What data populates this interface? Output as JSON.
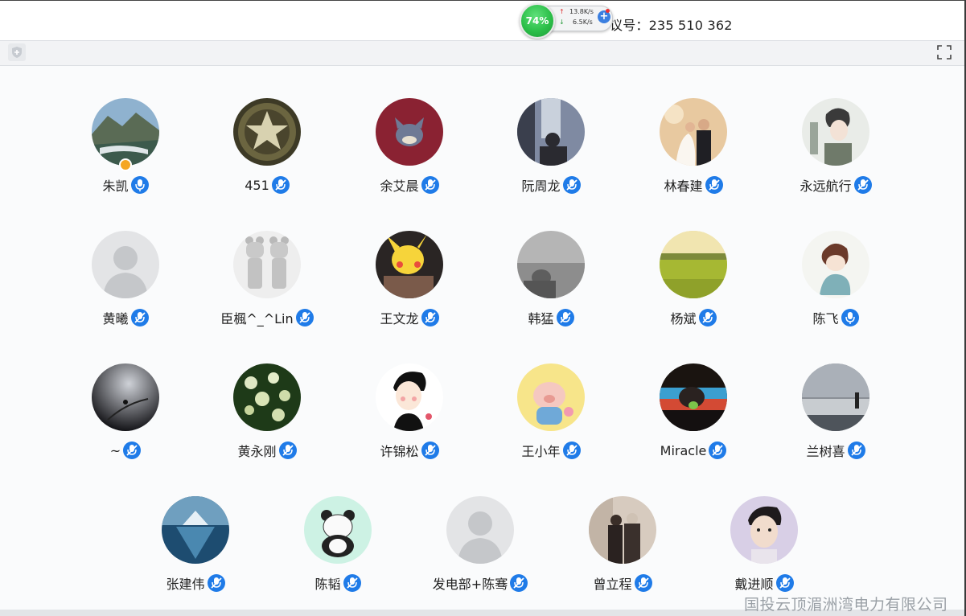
{
  "meeting": {
    "id_label": "议号：235 510 362"
  },
  "net_widget": {
    "percent": "74%",
    "upload": "13.8K/s",
    "download": "6.5K/s"
  },
  "participants": [
    {
      "name": "朱凯",
      "mic": "on",
      "host": true
    },
    {
      "name": "451",
      "mic": "muted"
    },
    {
      "name": "余艾晨",
      "mic": "muted"
    },
    {
      "name": "阮周龙",
      "mic": "muted"
    },
    {
      "name": "林春建",
      "mic": "muted"
    },
    {
      "name": "永远航行",
      "mic": "muted"
    },
    {
      "name": "黄曦",
      "mic": "muted"
    },
    {
      "name": "臣楓^_^Lin",
      "mic": "muted"
    },
    {
      "name": "王文龙",
      "mic": "muted"
    },
    {
      "name": "韩猛",
      "mic": "muted"
    },
    {
      "name": "杨斌",
      "mic": "muted"
    },
    {
      "name": "陈飞",
      "mic": "on"
    },
    {
      "name": "~",
      "mic": "muted"
    },
    {
      "name": "黄永刚",
      "mic": "muted"
    },
    {
      "name": "许锦松",
      "mic": "muted"
    },
    {
      "name": "王小年",
      "mic": "muted"
    },
    {
      "name": "Miracle",
      "mic": "muted"
    },
    {
      "name": "兰树喜",
      "mic": "muted"
    },
    {
      "name": "张建伟",
      "mic": "muted"
    },
    {
      "name": "陈韬",
      "mic": "muted"
    },
    {
      "name": "发电部+陈骞",
      "mic": "muted"
    },
    {
      "name": "曾立程",
      "mic": "muted"
    },
    {
      "name": "戴进顺",
      "mic": "muted"
    }
  ],
  "watermark": "国投云顶湄洲湾电力有限公司",
  "colors": {
    "mic_blue": "#1f7be8",
    "host_badge": "#f5a623",
    "net_green": "#2cbf49"
  }
}
